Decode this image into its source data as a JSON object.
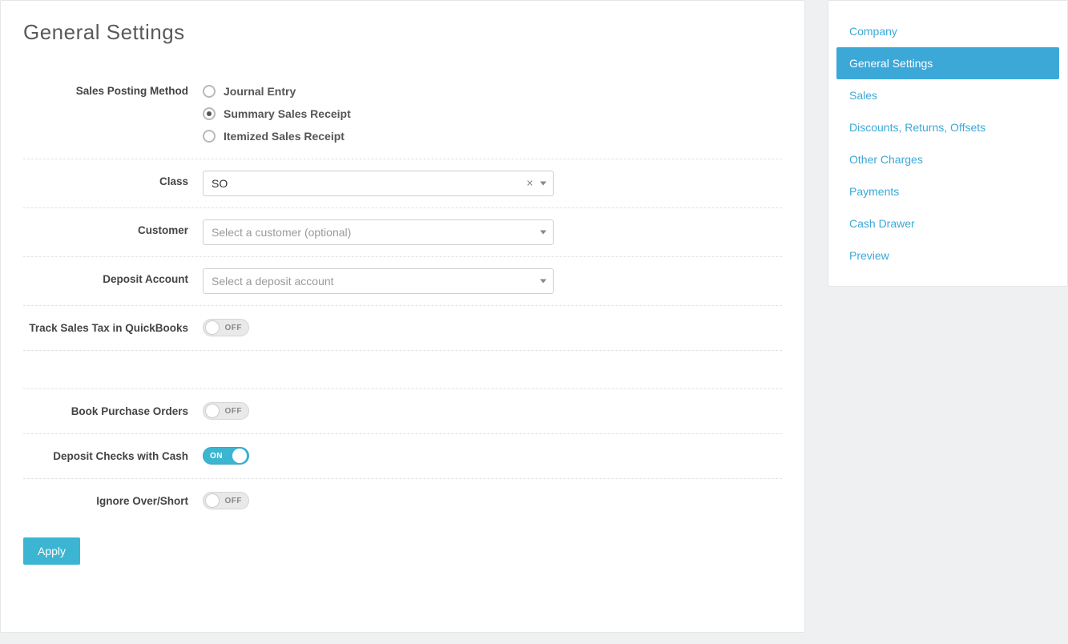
{
  "title": "General Settings",
  "labels": {
    "salesPostingMethod": "Sales Posting Method",
    "class": "Class",
    "customer": "Customer",
    "depositAccount": "Deposit Account",
    "trackSalesTax": "Track Sales Tax in QuickBooks",
    "bookPO": "Book Purchase Orders",
    "depositChecks": "Deposit Checks with Cash",
    "ignoreOverShort": "Ignore Over/Short"
  },
  "salesPosting": {
    "options": [
      {
        "label": "Journal Entry",
        "checked": false
      },
      {
        "label": "Summary Sales Receipt",
        "checked": true
      },
      {
        "label": "Itemized Sales Receipt",
        "checked": false
      }
    ]
  },
  "class": {
    "value": "SO",
    "clearable": true
  },
  "customer": {
    "placeholder": "Select a customer (optional)"
  },
  "depositAccount": {
    "placeholder": "Select a deposit account"
  },
  "toggles": {
    "trackSalesTax": {
      "on": false
    },
    "bookPO": {
      "on": false
    },
    "depositChecks": {
      "on": true
    },
    "ignoreOverShort": {
      "on": false
    },
    "onText": "ON",
    "offText": "OFF"
  },
  "apply": "Apply",
  "nav": [
    {
      "label": "Company",
      "active": false
    },
    {
      "label": "General Settings",
      "active": true
    },
    {
      "label": "Sales",
      "active": false
    },
    {
      "label": "Discounts, Returns, Offsets",
      "active": false
    },
    {
      "label": "Other Charges",
      "active": false
    },
    {
      "label": "Payments",
      "active": false
    },
    {
      "label": "Cash Drawer",
      "active": false
    },
    {
      "label": "Preview",
      "active": false
    }
  ]
}
